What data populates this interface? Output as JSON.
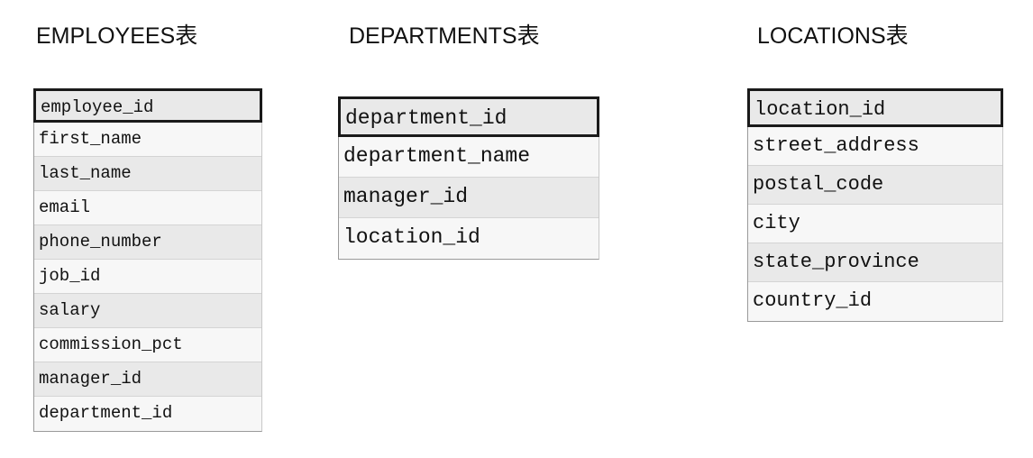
{
  "tables": [
    {
      "title": "EMPLOYEES表",
      "fields": [
        "employee_id",
        "first_name",
        "last_name",
        "email",
        "phone_number",
        "job_id",
        "salary",
        "commission_pct",
        "manager_id",
        "department_id"
      ]
    },
    {
      "title": "DEPARTMENTS表",
      "fields": [
        "department_id",
        "department_name",
        "manager_id",
        "location_id"
      ]
    },
    {
      "title": "LOCATIONS表",
      "fields": [
        "location_id",
        "street_address",
        "postal_code",
        "city",
        "state_province",
        "country_id"
      ]
    }
  ]
}
